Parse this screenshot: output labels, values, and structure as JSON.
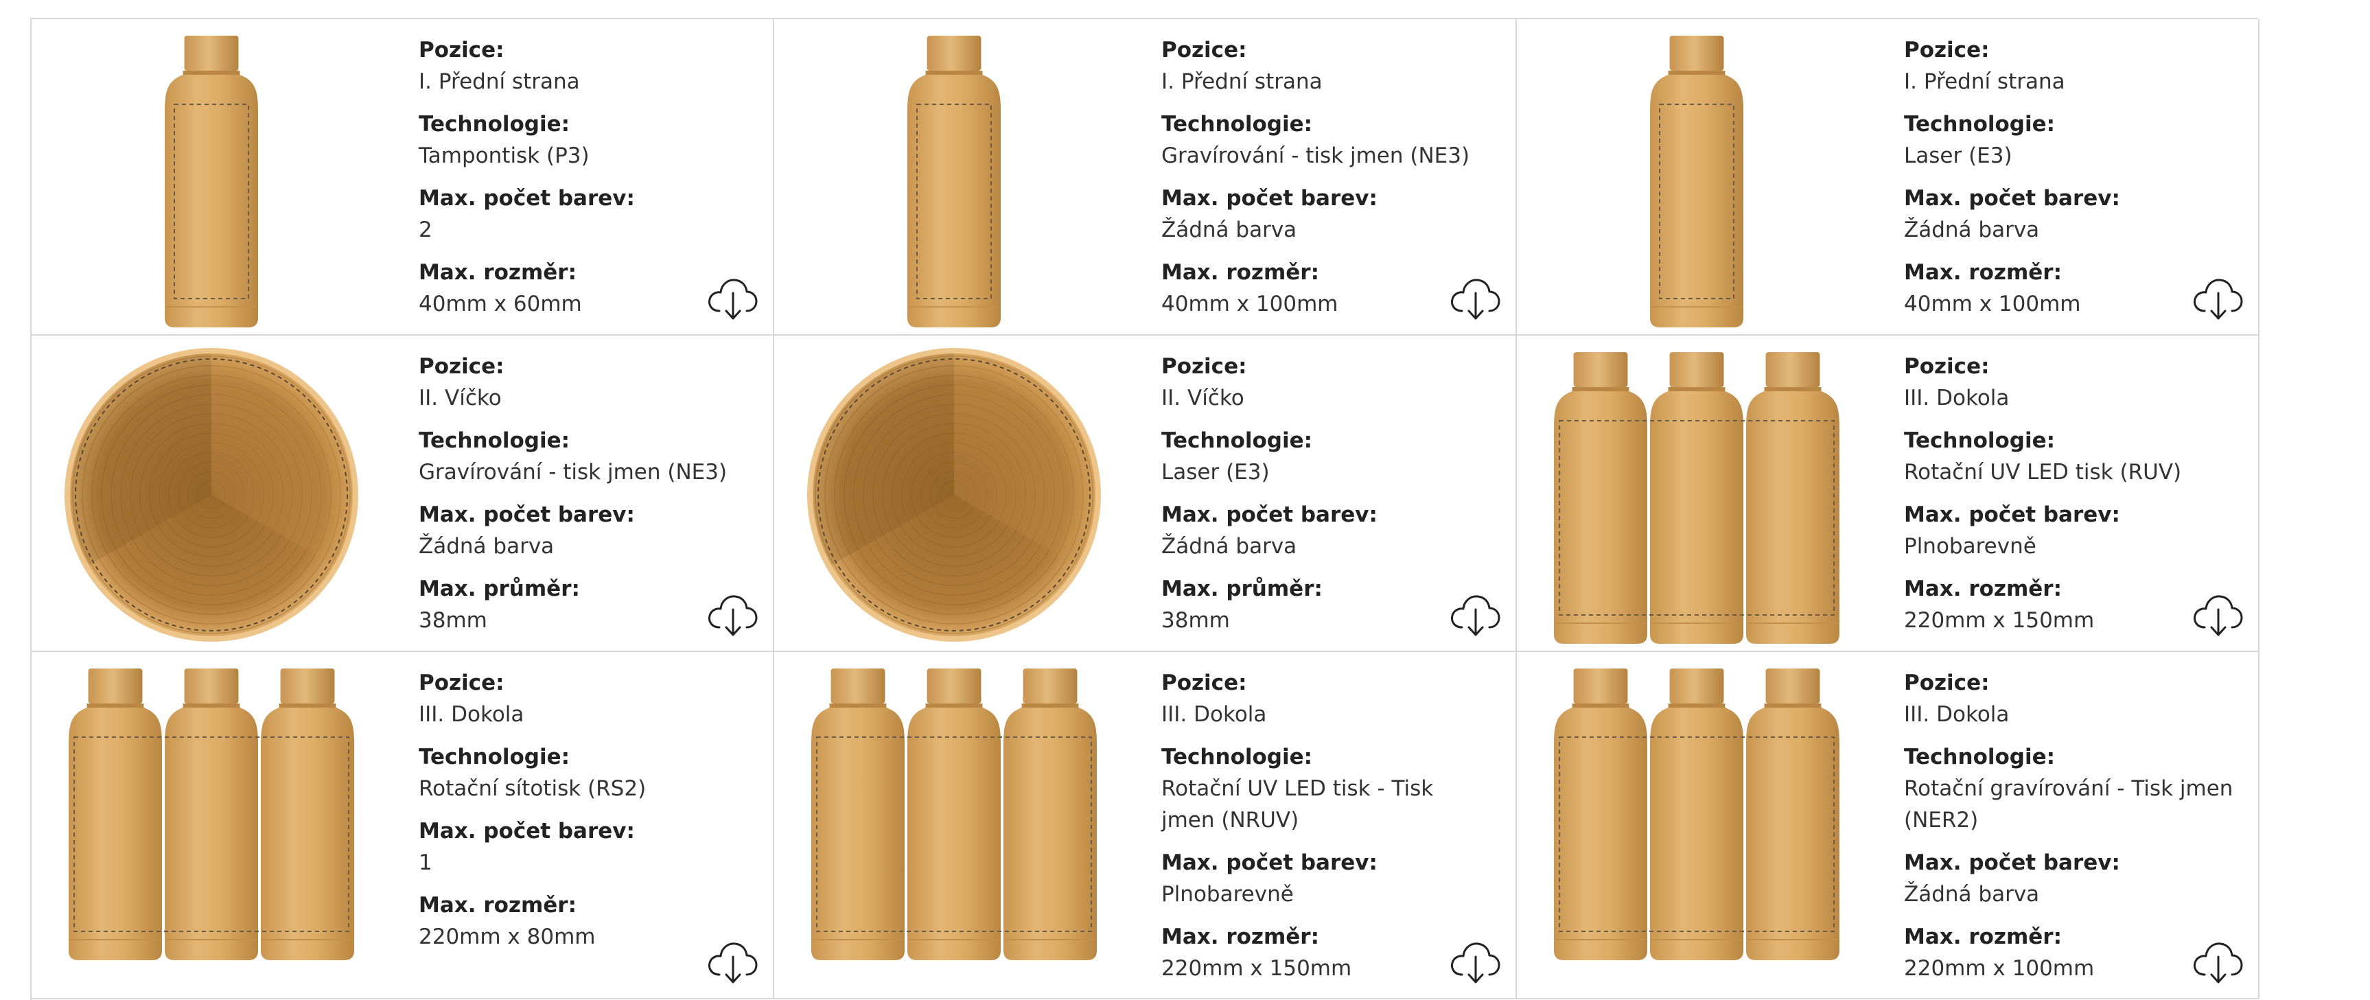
{
  "cells": [
    {
      "image": "single",
      "pos_label": "Pozice:",
      "pos": "I. Přední strana",
      "tech_label": "Technologie:",
      "tech": "Tampontisk (P3)",
      "col_label": "Max. počet barev:",
      "col": "2",
      "size_label": "Max. rozměr:",
      "size": "40mm x 60mm"
    },
    {
      "image": "single",
      "pos_label": "Pozice:",
      "pos": "I. Přední strana",
      "tech_label": "Technologie:",
      "tech": "Gravírování - tisk jmen (NE3)",
      "col_label": "Max. počet barev:",
      "col": "Žádná barva",
      "size_label": "Max. rozměr:",
      "size": "40mm x 100mm"
    },
    {
      "image": "single",
      "pos_label": "Pozice:",
      "pos": "I. Přední strana",
      "tech_label": "Technologie:",
      "tech": "Laser (E3)",
      "col_label": "Max. počet barev:",
      "col": "Žádná barva",
      "size_label": "Max. rozměr:",
      "size": "40mm x 100mm"
    },
    {
      "image": "lid",
      "pos_label": "Pozice:",
      "pos": "II. Víčko",
      "tech_label": "Technologie:",
      "tech": "Gravírování - tisk jmen (NE3)",
      "col_label": "Max. počet barev:",
      "col": "Žádná barva",
      "size_label": "Max. průměr:",
      "size": "38mm"
    },
    {
      "image": "lid",
      "pos_label": "Pozice:",
      "pos": "II. Víčko",
      "tech_label": "Technologie:",
      "tech": "Laser (E3)",
      "col_label": "Max. počet barev:",
      "col": "Žádná barva",
      "size_label": "Max. průměr:",
      "size": "38mm"
    },
    {
      "image": "triple",
      "pos_label": "Pozice:",
      "pos": "III. Dokola",
      "tech_label": "Technologie:",
      "tech": "Rotační UV LED tisk (RUV)",
      "col_label": "Max. počet barev:",
      "col": "Plnobarevně",
      "size_label": "Max. rozměr:",
      "size": "220mm x 150mm"
    },
    {
      "image": "triple",
      "pos_label": "Pozice:",
      "pos": "III. Dokola",
      "tech_label": "Technologie:",
      "tech": "Rotační sítotisk (RS2)",
      "col_label": "Max. počet barev:",
      "col": "1",
      "size_label": "Max. rozměr:",
      "size": "220mm x 80mm"
    },
    {
      "image": "triple",
      "pos_label": "Pozice:",
      "pos": "III. Dokola",
      "tech_label": "Technologie:",
      "tech": "Rotační UV LED tisk - Tisk jmen (NRUV)",
      "col_label": "Max. počet barev:",
      "col": "Plnobarevně",
      "size_label": "Max. rozměr:",
      "size": "220mm x 150mm"
    },
    {
      "image": "triple",
      "pos_label": "Pozice:",
      "pos": "III. Dokola",
      "tech_label": "Technologie:",
      "tech": "Rotační gravírování - Tisk jmen (NER2)",
      "col_label": "Max. počet barev:",
      "col": "Žádná barva",
      "size_label": "Max. rozměr:",
      "size": "220mm x 100mm"
    }
  ],
  "icons": {
    "download": "cloud-download-icon"
  },
  "colors": {
    "bottle": "#d9a863",
    "lid_dark": "#a9742e",
    "border": "#d8d8d8"
  }
}
